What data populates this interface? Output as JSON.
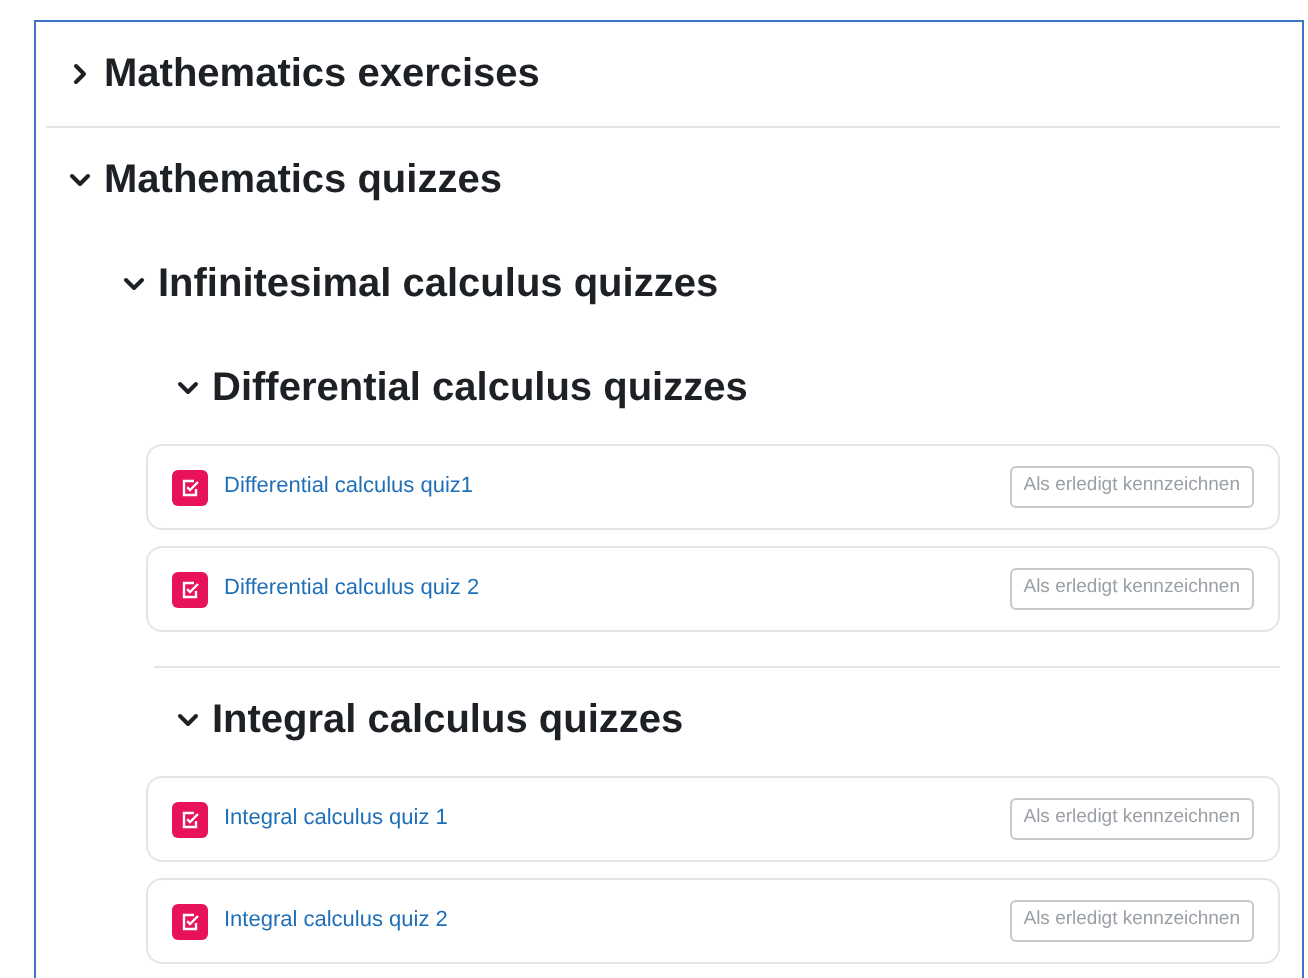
{
  "sections": [
    {
      "title": "Mathematics exercises",
      "expanded": false
    },
    {
      "title": "Mathematics quizzes",
      "expanded": true,
      "children": [
        {
          "title": "Infinitesimal calculus quizzes",
          "expanded": true,
          "children": [
            {
              "title": "Differential calculus quizzes",
              "expanded": true,
              "activities": [
                {
                  "title": "Differential calculus quiz1",
                  "button": "Als erledigt kennzeichnen"
                },
                {
                  "title": "Differential calculus quiz 2",
                  "button": "Als erledigt kennzeichnen"
                }
              ]
            },
            {
              "title": "Integral calculus quizzes",
              "expanded": true,
              "activities": [
                {
                  "title": "Integral calculus quiz 1",
                  "button": "Als erledigt kennzeichnen"
                },
                {
                  "title": "Integral calculus quiz 2",
                  "button": "Als erledigt kennzeichnen"
                }
              ]
            }
          ]
        }
      ]
    }
  ]
}
